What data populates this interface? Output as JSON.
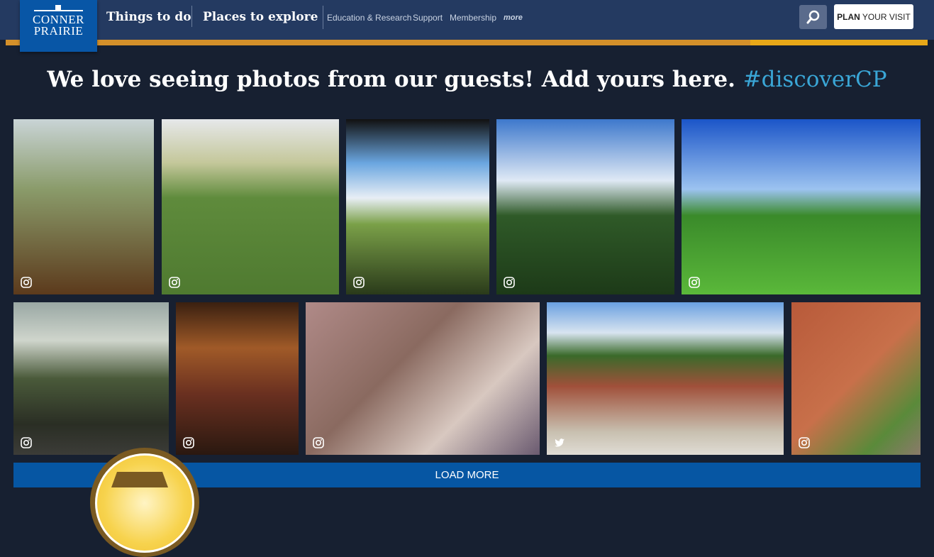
{
  "header": {
    "logo_line1": "CONNER",
    "logo_line2": "PRAIRIE",
    "nav_main": [
      "Things to do",
      "Places to explore"
    ],
    "nav_sub": [
      "Education & Research",
      "Support",
      "Membership"
    ],
    "more": "more",
    "plan_bold": "PLAN",
    "plan_rest": "YOUR VISIT"
  },
  "headline": {
    "text": "We love seeing photos from our guests! Add yours here. ",
    "hashtag": "#discoverCP"
  },
  "photos": [
    {
      "source": "instagram-icon",
      "bg": "linear-gradient(180deg,#c9d4d6 0,#8a9b6a 40%,#5c3a1c 100%)"
    },
    {
      "source": "instagram-icon",
      "bg": "linear-gradient(180deg,#e6e8ea 0,#c4c79a 25%,#5f8b3c 45%,#4f7a30 100%)"
    },
    {
      "source": "instagram-icon",
      "bg": "linear-gradient(180deg,#111 0,#6aa6e0 25%,#e8eef5 45%,#7aa048 60%,#2a3a1a 100%)"
    },
    {
      "source": "instagram-icon",
      "bg": "linear-gradient(180deg,#3d78cc 0,#dfe9f5 35%,#2f5a28 55%,#1d3a18 100%)"
    },
    {
      "source": "instagram-icon",
      "bg": "linear-gradient(180deg,#1b55c8 0,#9cc3f0 40%,#3a8a2a 55%,#5ab83a 100%)"
    },
    {
      "source": "instagram-icon",
      "bg": "linear-gradient(180deg,#9aa8a4 0,#cfd5cc 25%,#4a5a3a 50%,#2a2e24 80%,#3c3c38 100%)"
    },
    {
      "source": "instagram-icon",
      "bg": "linear-gradient(180deg,#3a2010 0,#a05a28 30%,#6a3020 60%,#2a1810 100%)"
    },
    {
      "source": "instagram-icon",
      "bg": "linear-gradient(135deg,#b08a88 0,#8a6a60 40%,#d8c8c0 70%,#6a5a70 100%)"
    },
    {
      "source": "twitter-icon",
      "bg": "linear-gradient(180deg,#6aa0e0 0,#d8e4f0 20%,#3a6a2a 35%,#a0503a 55%,#c8c0b0 85%,#e0dcd4 100%)"
    },
    {
      "source": "instagram-icon",
      "bg": "linear-gradient(135deg,#b85a3a 0,#c8704a 50%,#5a8a3a 80%,#8a7a6a 100%)"
    }
  ],
  "load_more": "LOAD MORE",
  "colors": {
    "header": "#243a61",
    "accent_orange": "#d4902a",
    "accent_yellow": "#e8a818",
    "button_blue": "#0656a3",
    "hashtag": "#3aa6d6"
  }
}
